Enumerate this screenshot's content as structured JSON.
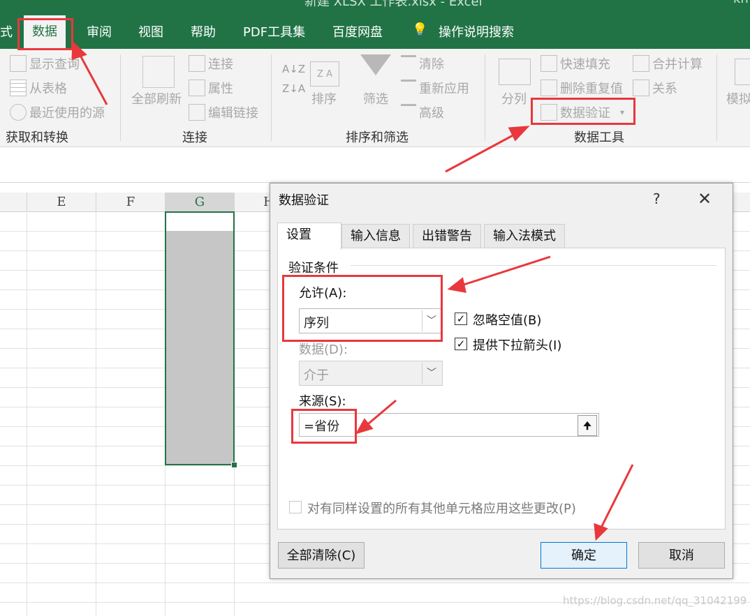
{
  "window": {
    "title": "新建 XLSX 工作表.xlsx  -  Excel",
    "user": "kn"
  },
  "ribbon_tabs": [
    {
      "label": "式"
    },
    {
      "label": "数据"
    },
    {
      "label": "审阅"
    },
    {
      "label": "视图"
    },
    {
      "label": "帮助"
    },
    {
      "label": "PDF工具集"
    },
    {
      "label": "百度网盘"
    },
    {
      "label": "操作说明搜索"
    }
  ],
  "ribbon": {
    "get_transform": {
      "items": [
        "显示查询",
        "从表格",
        "最近使用的源"
      ],
      "group": "获取和转换"
    },
    "connections": {
      "refresh_all": "全部刷新",
      "items": [
        "连接",
        "属性",
        "编辑链接"
      ],
      "group": "连接"
    },
    "sort_filter": {
      "sort": "排序",
      "filter": "筛选",
      "items": [
        "清除",
        "重新应用",
        "高级"
      ],
      "group": "排序和筛选"
    },
    "data_tools": {
      "split": "分列",
      "items": [
        "快速填充",
        "删除重复值",
        "数据验证"
      ],
      "items2": [
        "合并计算",
        "关系"
      ],
      "group": "数据工具"
    },
    "forecast": {
      "item": "模拟"
    }
  },
  "columns": [
    "E",
    "F",
    "G",
    "H"
  ],
  "dialog": {
    "title": "数据验证",
    "help": "?",
    "close": "✕",
    "tabs": [
      "设置",
      "输入信息",
      "出错警告",
      "输入法模式"
    ],
    "section": "验证条件",
    "allow_label": "允许(A):",
    "allow_value": "序列",
    "ignore_blank": "忽略空值(B)",
    "dropdown_arrow": "提供下拉箭头(I)",
    "data_label": "数据(D):",
    "data_value": "介于",
    "source_label": "来源(S):",
    "source_value": "=省份",
    "apply_all": "对有同样设置的所有其他单元格应用这些更改(P)",
    "clear_all": "全部清除(C)",
    "ok": "确定",
    "cancel": "取消"
  },
  "watermark": "https://blog.csdn.net/qq_31042199",
  "colors": {
    "excel_green": "#217346",
    "annotation_red": "#e8383d",
    "selection_gray": "#c6c6c6"
  }
}
